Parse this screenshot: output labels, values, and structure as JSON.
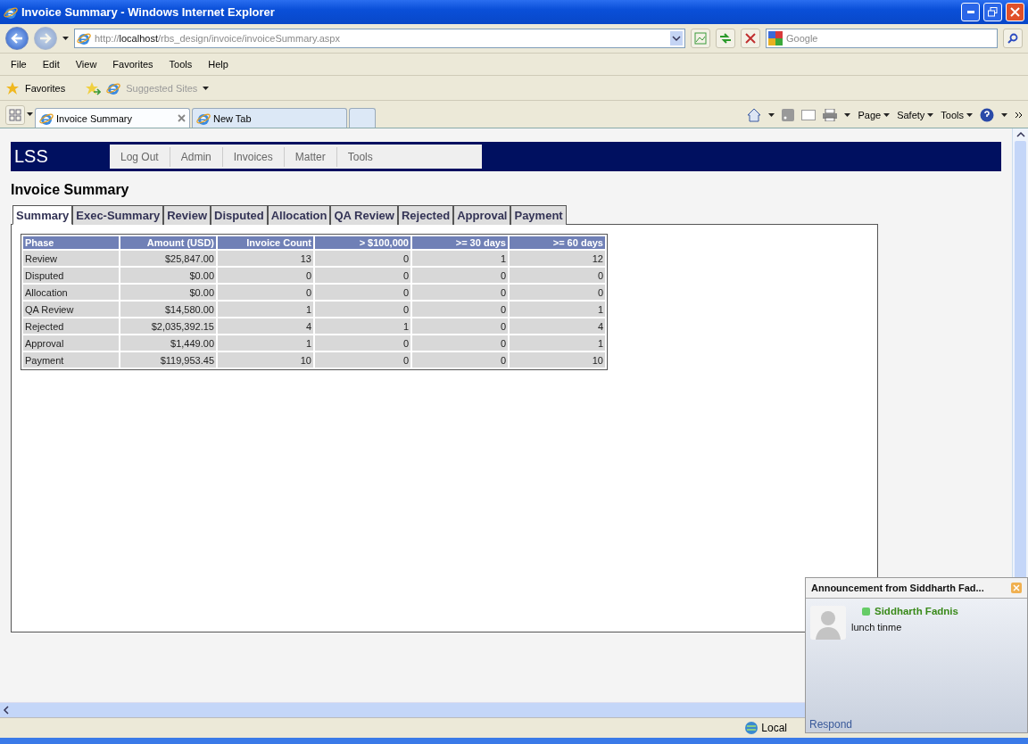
{
  "window": {
    "title": "Invoice Summary - Windows Internet Explorer"
  },
  "address_bar": {
    "url_scheme": "http://",
    "url_host": "localhost",
    "url_path": "/rbs_design/invoice/invoiceSummary.aspx"
  },
  "search": {
    "placeholder": "Google"
  },
  "menu": [
    "File",
    "Edit",
    "View",
    "Favorites",
    "Tools",
    "Help"
  ],
  "favorites_bar": {
    "favorites": "Favorites",
    "suggested_sites": "Suggested Sites"
  },
  "browser_tabs": [
    {
      "label": "Invoice Summary",
      "selected": true
    },
    {
      "label": "New Tab",
      "selected": false
    }
  ],
  "command_bar": [
    "Page",
    "Safety",
    "Tools"
  ],
  "page": {
    "logo": "LSS",
    "nav": [
      "Log Out",
      "Admin",
      "Invoices",
      "Matter",
      "Tools"
    ],
    "heading": "Invoice Summary",
    "tabs": [
      {
        "label": "Summary",
        "selected": true
      },
      {
        "label": "Exec-Summary",
        "selected": false
      },
      {
        "label": "Review",
        "selected": false
      },
      {
        "label": "Disputed",
        "selected": false
      },
      {
        "label": "Allocation",
        "selected": false
      },
      {
        "label": "QA Review",
        "selected": false
      },
      {
        "label": "Rejected",
        "selected": false
      },
      {
        "label": "Approval",
        "selected": false
      },
      {
        "label": "Payment",
        "selected": false
      }
    ],
    "table": {
      "columns": [
        "Phase",
        "Amount (USD)",
        "Invoice Count",
        "> $100,000",
        ">= 30 days",
        ">= 60 days"
      ],
      "rows": [
        [
          "Review",
          "$25,847.00",
          "13",
          "0",
          "1",
          "12"
        ],
        [
          "Disputed",
          "$0.00",
          "0",
          "0",
          "0",
          "0"
        ],
        [
          "Allocation",
          "$0.00",
          "0",
          "0",
          "0",
          "0"
        ],
        [
          "QA Review",
          "$14,580.00",
          "1",
          "0",
          "0",
          "1"
        ],
        [
          "Rejected",
          "$2,035,392.15",
          "4",
          "1",
          "0",
          "4"
        ],
        [
          "Approval",
          "$1,449.00",
          "1",
          "0",
          "0",
          "1"
        ],
        [
          "Payment",
          "$119,953.45",
          "10",
          "0",
          "0",
          "10"
        ]
      ]
    }
  },
  "popup": {
    "title": "Announcement from Siddharth Fad...",
    "sender": "Siddharth Fadnis",
    "message": "lunch tinme",
    "action": "Respond"
  },
  "status_bar": {
    "zone": "Local"
  }
}
